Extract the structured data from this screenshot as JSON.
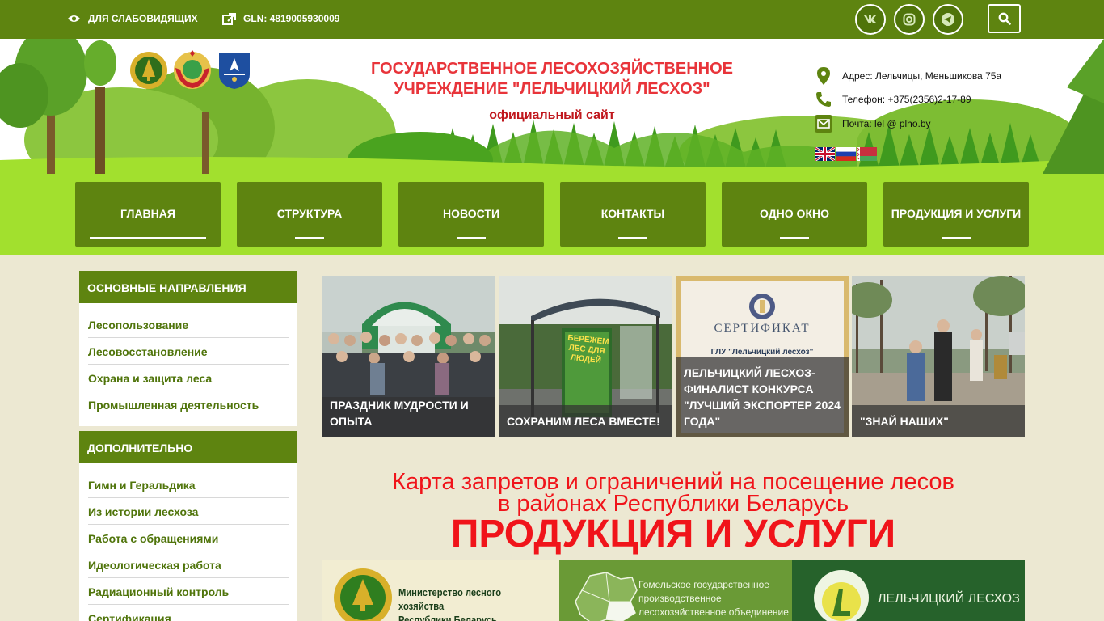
{
  "topbar": {
    "accessibility_label": "ДЛЯ СЛАБОВИДЯЩИХ",
    "gln_label": "GLN: 4819005930009"
  },
  "header": {
    "title": "ГОСУДАРСТВЕННОЕ ЛЕСОХОЗЯЙСТВЕННОЕ УЧРЕЖДЕНИЕ \"ЛЕЛЬЧИЦКИЙ ЛЕСХОЗ\"",
    "subtitle": "официальный сайт",
    "address": "Адрес: Лельчицы, Меньшикова 75а",
    "phone": "Телефон: +375(2356)2-17-89",
    "email": "Почта: lel @ plho.by"
  },
  "nav": {
    "items": [
      {
        "label": "ГЛАВНАЯ"
      },
      {
        "label": "СТРУКТУРА"
      },
      {
        "label": "НОВОСТИ"
      },
      {
        "label": "КОНТАКТЫ"
      },
      {
        "label": "ОДНО ОКНО"
      },
      {
        "label": "ПРОДУКЦИЯ И УСЛУГИ"
      }
    ]
  },
  "sidebar": {
    "main": {
      "title": "ОСНОВНЫЕ НАПРАВЛЕНИЯ",
      "items": [
        "Лесопользование",
        "Лесовосстановление",
        "Охрана и защита леса",
        "Промышленная деятельность"
      ]
    },
    "extra": {
      "title": "ДОПОЛНИТЕЛЬНО",
      "items": [
        "Гимн и Геральдика",
        "Из истории лесхоза",
        "Работа с обращениями",
        "Идеологическая работа",
        "Радиационный контроль",
        "Сертификация"
      ]
    }
  },
  "news": [
    {
      "caption": "ПРАЗДНИК МУДРОСТИ И ОПЫТА"
    },
    {
      "caption": "СОХРАНИМ ЛЕСА ВМЕСТЕ!",
      "sign_text": "БЕРЕЖЕМ ЛЕС ДЛЯ ЛЮДЕЙ"
    },
    {
      "caption": "ЛЕЛЬЧИЦКИЙ ЛЕСХОЗ-ФИНАЛИСТ КОНКУРСА \"ЛУЧШИЙ ЭКСПОРТЕР 2024 ГОДА\"",
      "cert_title": "СЕРТИФИКАТ",
      "cert_org": "ГЛУ \"Лельчицкий лесхоз\""
    },
    {
      "caption": "\"ЗНАЙ НАШИХ\""
    }
  ],
  "content": {
    "map_link_line1": "Карта запретов и ограничений на посещение лесов",
    "map_link_line2": "в районах Республики Беларусь",
    "products_title": "ПРОДУКЦИЯ И УСЛУГИ"
  },
  "banner": {
    "ministry": "Министерство лесного хозяйства Республики Беларусь",
    "ministry_line1": "Министерство лесного хозяйства",
    "ministry_line2": "Республики Беларусь",
    "gomel_line1": "Гомельское государственное",
    "gomel_line2": "производственное",
    "gomel_line3": "лесохозяйственное объединение",
    "leshoz": "ЛЕЛЬЧИЦКИЙ ЛЕСХОЗ"
  },
  "colors": {
    "brand_green": "#5e8410",
    "light_green": "#a2e02e",
    "title_red": "#e8343a",
    "content_red": "#f0141a"
  }
}
